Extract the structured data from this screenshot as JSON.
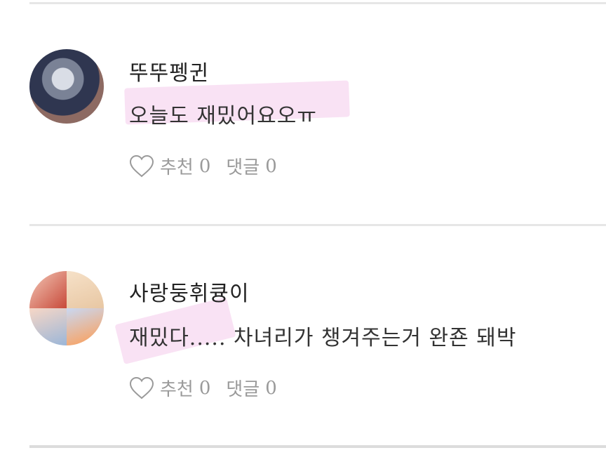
{
  "comments": [
    {
      "author": "뚜뚜펭귄",
      "text": "오늘도 재밌어요오ㅠ",
      "like_label": "추천",
      "like_count": "0",
      "reply_label": "댓글",
      "reply_count": "0"
    },
    {
      "author": "사랑둥휘큥이",
      "text": "재밌다..... 차녀리가 챙겨주는거 완죤 돼박",
      "like_label": "추천",
      "like_count": "0",
      "reply_label": "댓글",
      "reply_count": "0"
    }
  ],
  "colors": {
    "highlight": "#f6d2ee",
    "divider": "#e6e6e6",
    "muted_text": "#9a9a9a"
  },
  "icons": {
    "like": "heart-outline-icon"
  }
}
